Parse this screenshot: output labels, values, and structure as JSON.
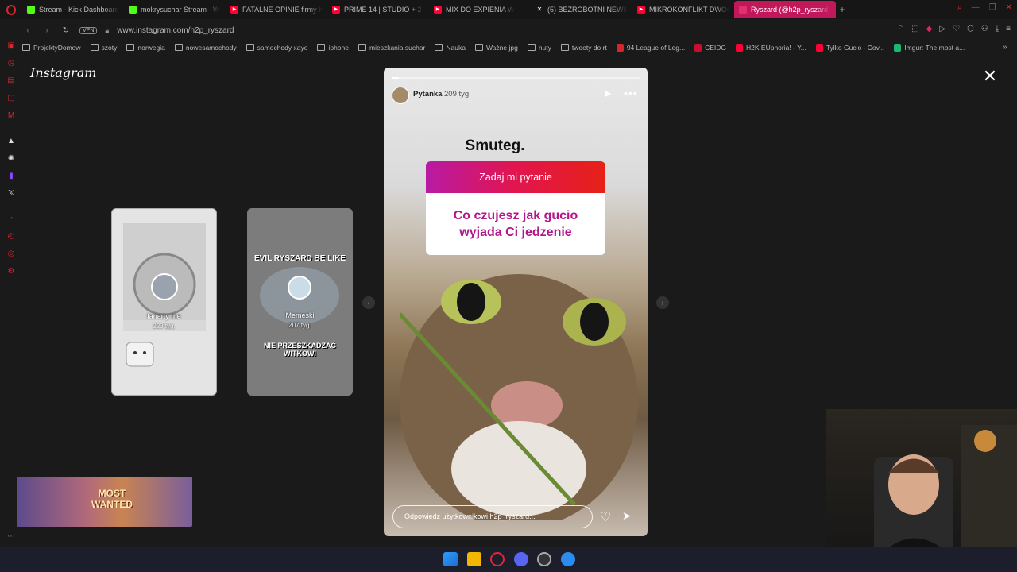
{
  "tabs": [
    {
      "label": "Stream - Kick Dashboard",
      "icon": "kick-icon",
      "color": "#53fc18"
    },
    {
      "label": "mokrysuchar Stream - W",
      "icon": "kick-icon",
      "color": "#53fc18"
    },
    {
      "label": "FATALNE OPINIE firmy Ki",
      "icon": "youtube-icon",
      "color": "#ff0033"
    },
    {
      "label": "PRIME 14 | STUDIO + 2 D",
      "icon": "youtube-icon",
      "color": "#ff0033"
    },
    {
      "label": "MIX DO EXPIENIA W",
      "icon": "youtube-icon",
      "color": "#ff0033"
    },
    {
      "label": "(5) BEZROBOTNI NEWS x",
      "icon": "x-icon",
      "color": "#ffffff"
    },
    {
      "label": "MIKROKONFLIKT DWÓCH",
      "icon": "youtube-icon",
      "color": "#ff0033"
    },
    {
      "label": "Ryszard (@h2p_ryszard)",
      "icon": "instagram-icon",
      "color": "#e1306c",
      "active": true
    }
  ],
  "address": {
    "url": "www.instagram.com/h2p_ryszard",
    "vpn": "VPN"
  },
  "bookmarks": [
    {
      "label": "ProjektyDomow",
      "type": "folder"
    },
    {
      "label": "szoty",
      "type": "folder"
    },
    {
      "label": "norwegia",
      "type": "folder"
    },
    {
      "label": "nowesamochody",
      "type": "folder"
    },
    {
      "label": "samochody xayo",
      "type": "folder"
    },
    {
      "label": "iphone",
      "type": "folder"
    },
    {
      "label": "mieszkania suchar",
      "type": "folder"
    },
    {
      "label": "Nauka",
      "type": "folder"
    },
    {
      "label": "Ważne jpg",
      "type": "folder"
    },
    {
      "label": "nuty",
      "type": "folder"
    },
    {
      "label": "tweety do rt",
      "type": "folder"
    },
    {
      "label": "94 League of Leg...",
      "type": "site",
      "color": "#d8262f"
    },
    {
      "label": "CEIDG",
      "type": "site",
      "color": "#c8102e"
    },
    {
      "label": "H2K EUphoria! - Y...",
      "type": "site",
      "color": "#ff0033"
    },
    {
      "label": "Tylko Gucio - Cov...",
      "type": "site",
      "color": "#ff0033"
    },
    {
      "label": "Imgur: The most a...",
      "type": "site",
      "color": "#1bb76e"
    }
  ],
  "instagram": {
    "logo": "Instagram",
    "previews": [
      {
        "name": "fanarty me",
        "time": "223 tyg."
      },
      {
        "name": "Memeski",
        "time": "207 tyg.",
        "caption_top": "EVIL RYSZARD BE LIKE",
        "caption_bottom": "NIE PRZESZKADZAĆ WITKOWI"
      }
    ],
    "story": {
      "user": "Pytanka",
      "time": "209 tyg.",
      "heading": "Smuteg.",
      "question_title": "Zadaj mi pytanie",
      "question_text": "Co czujesz jak gucio wyjada Ci jedzenie",
      "reply_placeholder": "Odpowiedz użytkownikowi h2p_ryszard..."
    }
  },
  "overlay": {
    "game_banner": "MOST WANTED"
  }
}
